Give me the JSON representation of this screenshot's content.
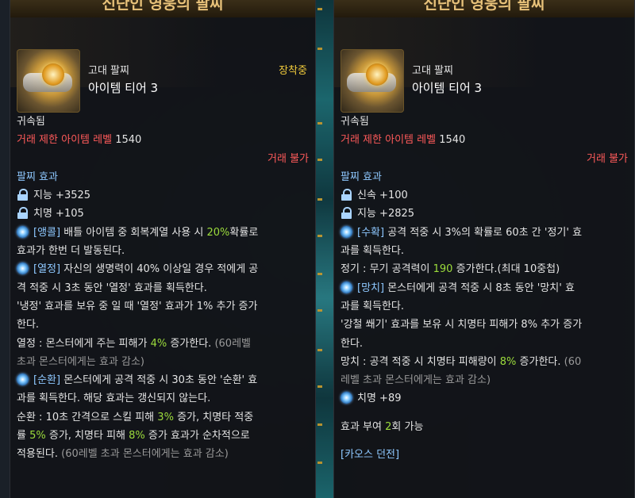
{
  "left": {
    "title": "신단인 영웅의 팔찌",
    "grade": "고대 팔찌",
    "tier": "아이템 티어 3",
    "equipped": "장착중",
    "bound": "귀속됨",
    "trade_level_label": "거래 제한 아이템 레벨",
    "trade_level_value": "1540",
    "untradable": "거래 불가",
    "effects_title": "팔찌 효과",
    "stat1": "지능 +3525",
    "stat2": "치명 +105",
    "e1a_tag": "[앵콜]",
    "e1a_text": "배틀 아이템 중 회복계열 사용 시",
    "e1a_pct": "20%",
    "e1a_rest": "확률로",
    "e1b": "효과가 한번 더 발동된다.",
    "e2a_tag": "[열정]",
    "e2a_text": "자신의 생명력이 40% 이상일 경우 적에게 공",
    "e2b": "격 적중 시 3초 동안 '열정' 효과를 획득한다.",
    "e2c": "'냉정' 효과를 보유 중 일 때 '열정' 효과가 1% 추가 증가",
    "e2d": "한다.",
    "e2e_pre": "열정 : 몬스터에게 주는 피해가",
    "e2e_pct": "4%",
    "e2e_post": "증가한다.",
    "e2e_gray": "(60레벨",
    "e2f_gray": "초과 몬스터에게는 효과 감소)",
    "e3a_tag": "[순환]",
    "e3a_text": "몬스터에게 공격 적중 시 30초 동안 '순환' 효",
    "e3b": "과를 획득한다. 해당 효과는 갱신되지 않는다.",
    "e3c_pre": "순환 : 10초 간격으로 스킬 피해",
    "e3c_pct": "3%",
    "e3c_post": "증가, 치명타 적중",
    "e3d_pre": "률",
    "e3d_pct1": "5%",
    "e3d_mid": "증가, 치명타 피해",
    "e3d_pct2": "8%",
    "e3d_post": "증가 효과가 순차적으로",
    "e3e_pre": "적용된다.",
    "e3e_gray": "(60레벨 초과 몬스터에게는 효과 감소)"
  },
  "right": {
    "title": "신단인 영웅의 팔찌",
    "grade": "고대 팔찌",
    "tier": "아이템 티어 3",
    "bound": "귀속됨",
    "trade_level_label": "거래 제한 아이템 레벨",
    "trade_level_value": "1540",
    "untradable": "거래 불가",
    "effects_title": "팔찌 효과",
    "stat1": "신속 +100",
    "stat2": "지능 +2825",
    "e1a_tag": "[수확]",
    "e1a_text": "공격 적중 시 3%의 확률로 60초 간 '정기' 효",
    "e1b": "과를 획득한다.",
    "e1c_pre": "정기 : 무기 공격력이",
    "e1c_val": "190",
    "e1c_post": "증가한다.(최대 10중첩)",
    "e2a_tag": "[망치]",
    "e2a_text": "몬스터에게 공격 적중 시 8초 동안 '망치' 효",
    "e2b": "과를 획득한다.",
    "e2c": "'강철 쐐기' 효과를 보유 시 치명타 피해가 8% 추가 증가",
    "e2d": "한다.",
    "e2e_pre": "망치 : 공격 적중 시 치명타 피해량이",
    "e2e_pct": "8%",
    "e2e_post": "증가한다.",
    "e2e_gray": "(60",
    "e2f_gray": "레벨 초과 몬스터에게는 효과 감소)",
    "stat3": "치명 +89",
    "grant_pre": "효과 부여",
    "grant_num": "2",
    "grant_post": "회 가능",
    "chaos": "[카오스 던전]"
  },
  "icons": {
    "lock": "lock-icon",
    "effect": "effect-gem-icon"
  }
}
